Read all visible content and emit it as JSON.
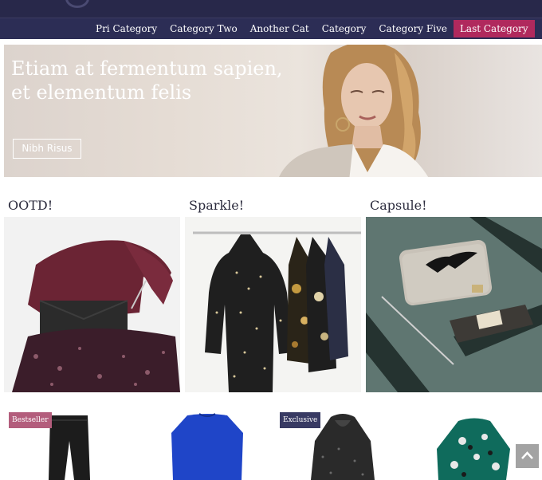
{
  "nav": {
    "items": [
      {
        "label": "Pri Category"
      },
      {
        "label": "Category Two"
      },
      {
        "label": "Another Cat"
      },
      {
        "label": "Category"
      },
      {
        "label": "Category Five"
      },
      {
        "label": "Last Category",
        "active": true
      }
    ],
    "active_color": "#b0295d"
  },
  "hero": {
    "title_line1": "Etiam at fermentum sapien,",
    "title_line2": "et elementum felis",
    "button_label": "Nibh Risus"
  },
  "tiles": [
    {
      "title": "OOTD!"
    },
    {
      "title": "Sparkle!"
    },
    {
      "title": "Capsule!"
    }
  ],
  "products": [
    {
      "badge": "Bestseller",
      "badge_color": "#b35d7c",
      "item": "black-jeans"
    },
    {
      "badge": "",
      "item": "blue-top"
    },
    {
      "badge": "Exclusive",
      "badge_color": "#383a63",
      "item": "knit-hoodie"
    },
    {
      "badge": "",
      "item": "floral-blouse"
    }
  ],
  "colors": {
    "header": "#28284a",
    "nav": "#2c2d55"
  },
  "icons": {
    "scroll_top": "chevron-up-icon"
  }
}
